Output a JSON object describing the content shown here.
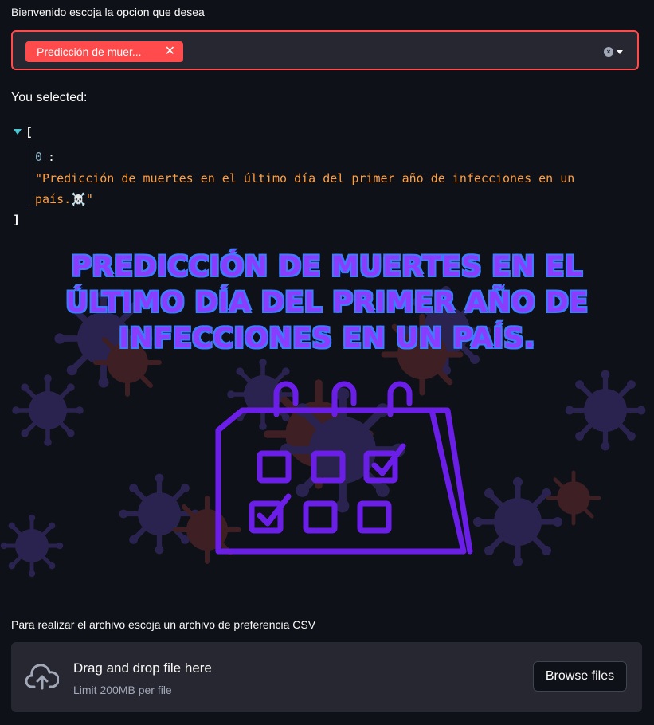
{
  "select": {
    "label": "Bienvenido escoja la opcion que desea",
    "selected_tag": "Predicción de muer...",
    "tag_remove": "✕",
    "clear": "×"
  },
  "result": {
    "heading": "You selected:",
    "json_open": "[",
    "json_index": "0",
    "json_colon": ":",
    "json_value": "\"Predicción de muertes en el último día del primer año de infecciones en un país.☠️\"",
    "json_close": "]"
  },
  "hero": {
    "title": "PREDICCIÓN DE MUERTES EN EL ÚLTIMO DÍA DEL PRIMER AÑO DE INFECCIONES EN UN PAÍS."
  },
  "upload": {
    "label": "Para realizar el archivo escoja un archivo de preferencia CSV",
    "drop_title": "Drag and drop file here",
    "drop_limit": "Limit 200MB per file",
    "browse": "Browse files"
  },
  "colors": {
    "accent": "#ff4b4b",
    "background": "#0e1117",
    "panel": "#262730",
    "title_fill": "#8b3dff",
    "title_outline": "#3d7bff",
    "json_string": "#ff9f43"
  },
  "icons": [
    "close-icon",
    "clear-icon",
    "chevron-down-icon",
    "expand-triangle-icon",
    "virus-icon",
    "calendar-icon",
    "cloud-upload-icon"
  ]
}
